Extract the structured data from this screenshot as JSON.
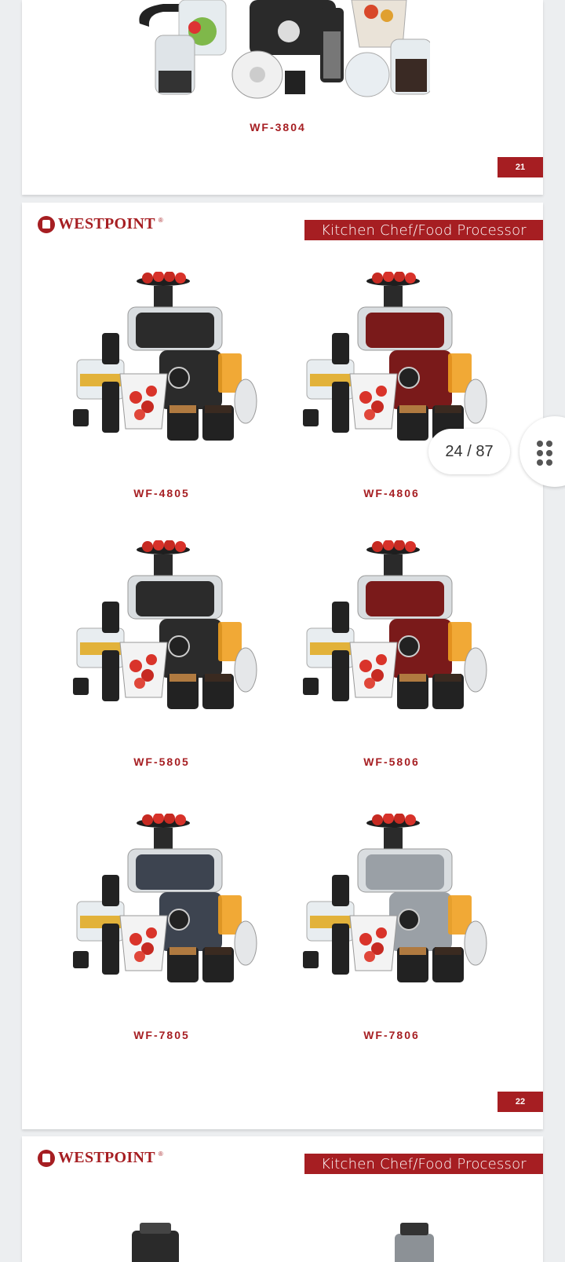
{
  "brand": {
    "name": "WESTPOINT",
    "reg": "®"
  },
  "section_title": "Kitchen Chef/Food Processor",
  "page1": {
    "model": "WF-3804",
    "page_number": "21"
  },
  "page2": {
    "page_number": "22",
    "products": [
      {
        "model": "WF-4805",
        "body_color": "#2b2b2b"
      },
      {
        "model": "WF-4806",
        "body_color": "#7a1a1a"
      },
      {
        "model": "WF-5805",
        "body_color": "#2b2b2b"
      },
      {
        "model": "WF-5806",
        "body_color": "#7a1a1a"
      },
      {
        "model": "WF-7805",
        "body_color": "#3d4450"
      },
      {
        "model": "WF-7806",
        "body_color": "#9aa0a6"
      }
    ]
  },
  "viewer": {
    "page_indicator": "24 / 87",
    "menu_icon": "grid-dots-icon"
  },
  "colors": {
    "accent": "#a61e22",
    "background": "#eceef0"
  }
}
